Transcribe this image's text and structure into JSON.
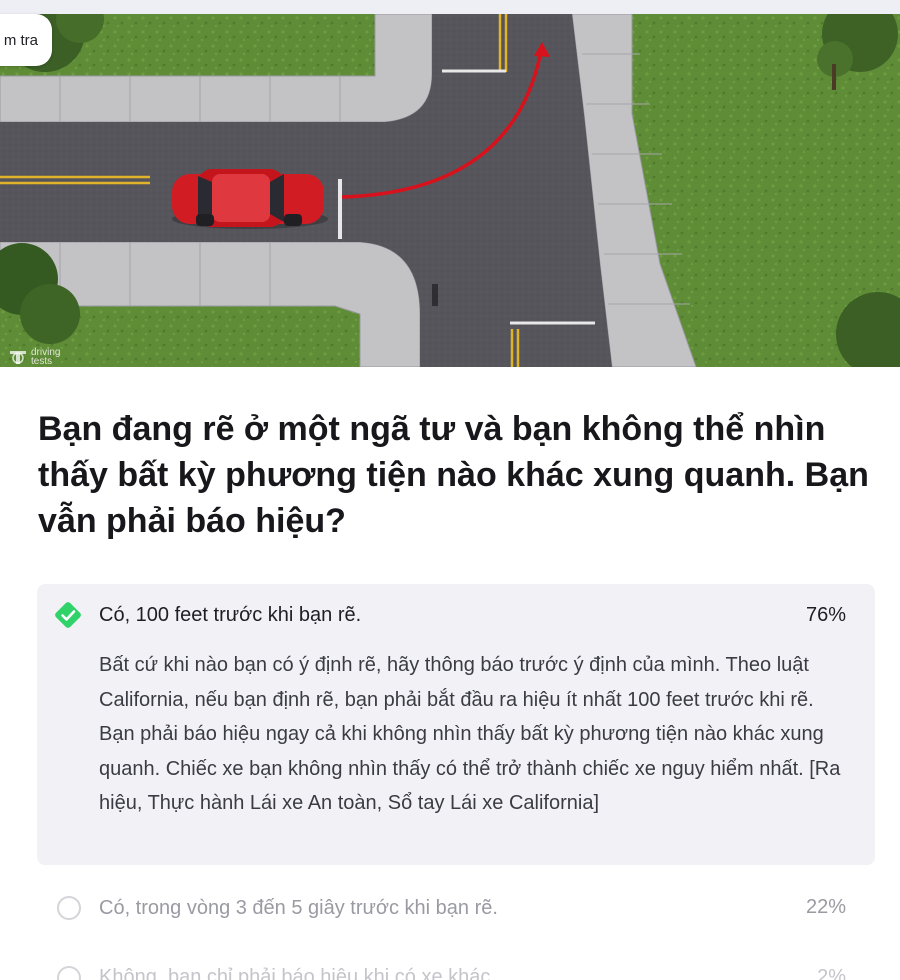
{
  "header": {
    "back_pill_label": "m tra"
  },
  "image": {
    "watermark_line1": "driving",
    "watermark_line2": "tests"
  },
  "question": {
    "text": "Bạn đang rẽ ở một ngã tư và bạn không thể nhìn thấy bất kỳ phương tiện nào khác xung quanh. Bạn vẫn phải báo hiệu?"
  },
  "answers": [
    {
      "label": "Có, 100 feet trước khi bạn rẽ.",
      "percent": "76%",
      "correct": true,
      "explanation": "Bất cứ khi nào bạn có ý định rẽ, hãy thông báo trước ý định của mình. Theo luật California, nếu bạn định rẽ, bạn phải bắt đầu ra hiệu ít nhất 100 feet trước khi rẽ. Bạn phải báo hiệu ngay cả khi không nhìn thấy bất kỳ phương tiện nào khác xung quanh. Chiếc xe bạn không nhìn thấy có thể trở thành chiếc xe nguy hiểm nhất. [Ra hiệu, Thực hành Lái xe An toàn, Sổ tay Lái xe California]"
    },
    {
      "label": "Có, trong vòng 3 đến 5 giây trước khi bạn rẽ.",
      "percent": "22%",
      "correct": false
    },
    {
      "label": "Không, bạn chỉ phải báo hiệu khi có xe khác.",
      "percent": "2%",
      "correct": false
    }
  ],
  "colors": {
    "correct_green": "#2fd36a",
    "card_bg": "#f2f2f6",
    "arrow_red": "#d8121c",
    "car_red": "#d21c24"
  },
  "icons": {
    "correct": "check-diamond-icon",
    "unselected": "radio-circle-icon",
    "logo": "driving-tests-logo-icon"
  }
}
